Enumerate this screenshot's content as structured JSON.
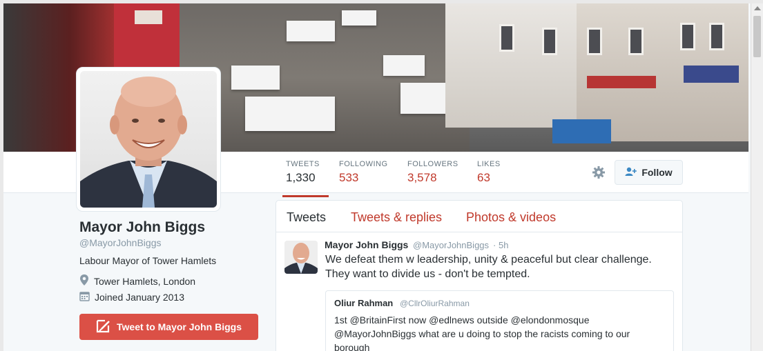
{
  "profile": {
    "name": "Mayor John Biggs",
    "handle": "@MayorJohnBiggs",
    "bio": "Labour Mayor of Tower Hamlets",
    "location": "Tower Hamlets, London",
    "joined": "Joined January 2013",
    "tweet_to_label": "Tweet to Mayor John Biggs"
  },
  "stats": [
    {
      "label": "TWEETS",
      "value": "1,330"
    },
    {
      "label": "FOLLOWING",
      "value": "533"
    },
    {
      "label": "FOLLOWERS",
      "value": "3,578"
    },
    {
      "label": "LIKES",
      "value": "63"
    }
  ],
  "actions": {
    "follow_label": "Follow"
  },
  "tabs": [
    {
      "label": "Tweets"
    },
    {
      "label": "Tweets & replies"
    },
    {
      "label": "Photos & videos"
    }
  ],
  "tweet": {
    "author": "Mayor John Biggs",
    "handle": "@MayorJohnBiggs",
    "separator": "·",
    "time": "5h",
    "text": "We defeat them w leadership, unity & peaceful but clear challenge.\nThey want to divide us - don't be tempted.",
    "quote": {
      "author": "Oliur Rahman",
      "handle": "@CllrOliurRahman",
      "text": "1st @BritainFirst now @edlnews outside @elondonmosque\n@MayorJohnBiggs what are u doing to stop the racists coming to our\nborough"
    }
  },
  "colors": {
    "accent": "#c0392b",
    "tweet_button": "#db5046",
    "text_primary": "#292f33",
    "text_secondary": "#66757f"
  }
}
